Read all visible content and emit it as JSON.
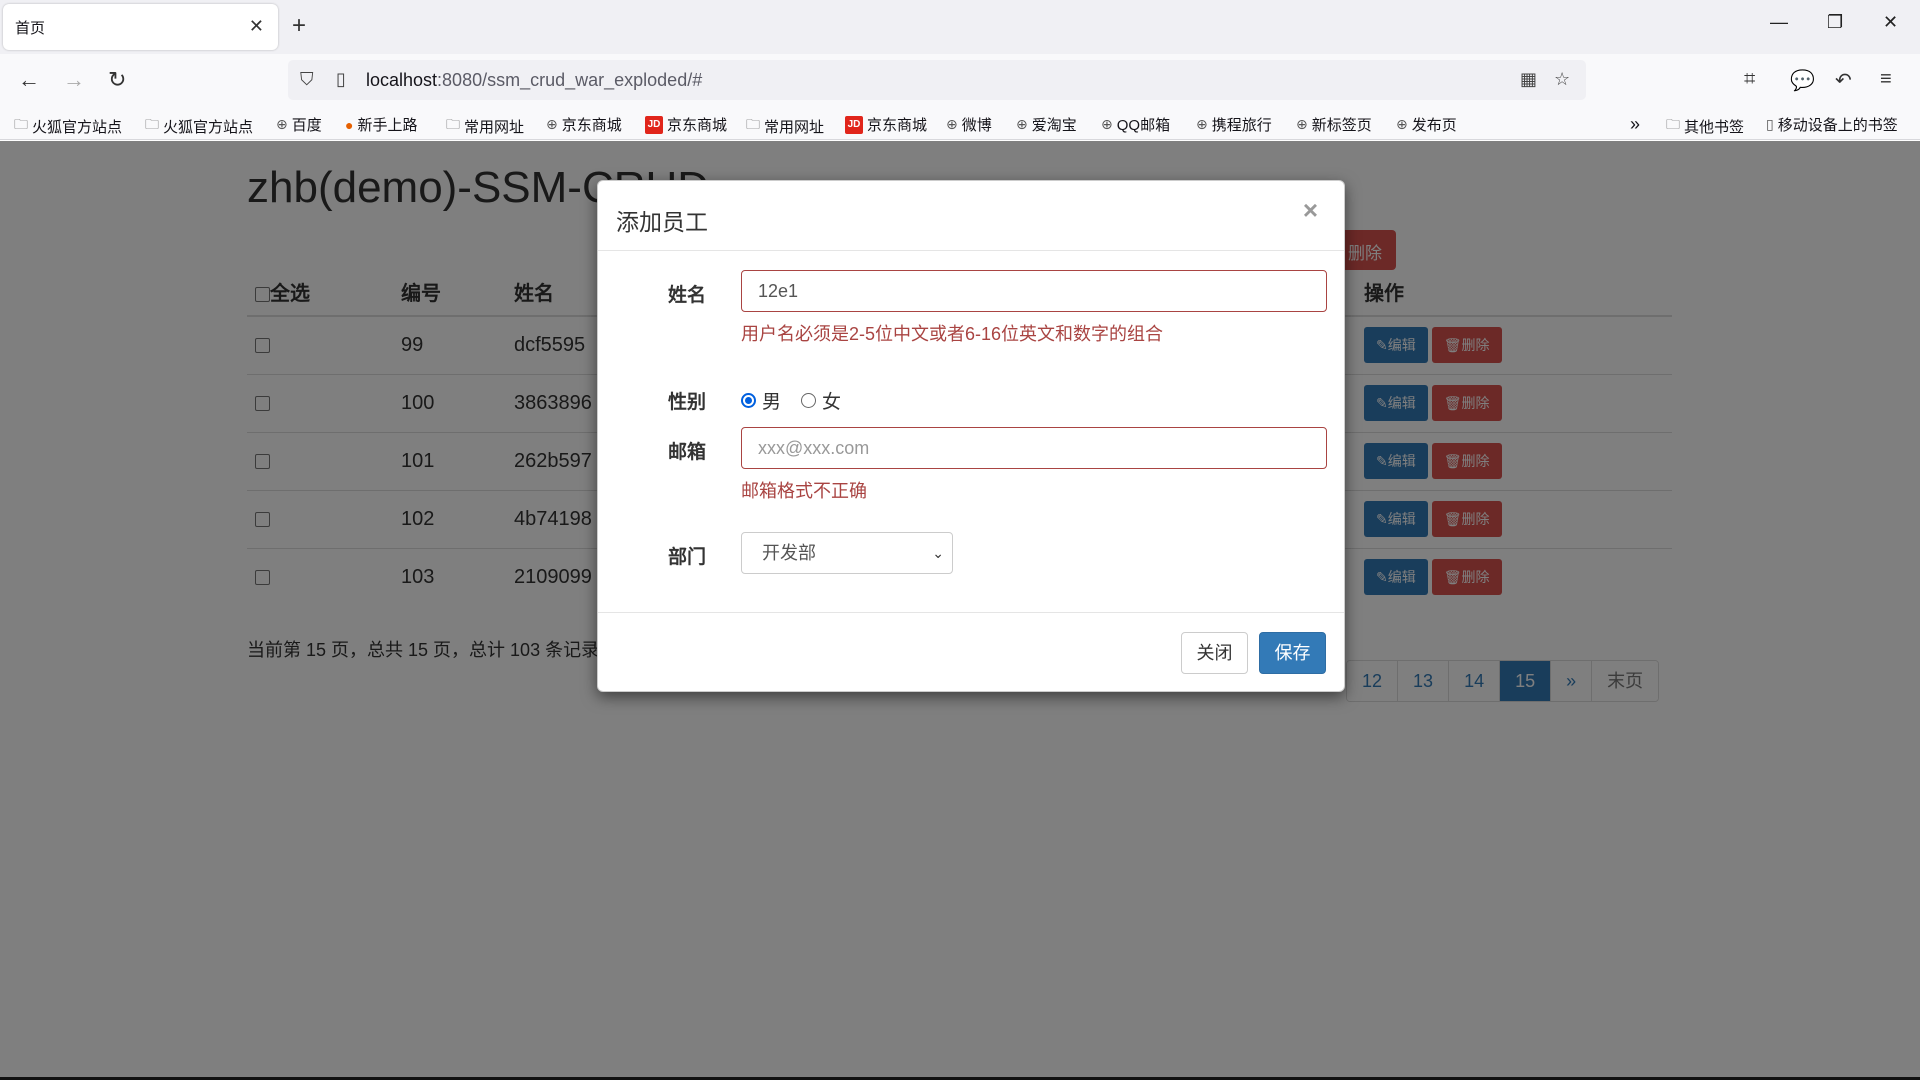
{
  "browser": {
    "tab_title": "首页",
    "tab_close": "✕",
    "new_tab": "+",
    "url_host": "localhost",
    "url_rest": ":8080/ssm_crud_war_exploded/#",
    "bookmarks": [
      "火狐官方站点",
      "火狐官方站点",
      "百度",
      "新手上路",
      "常用网址",
      "京东商城",
      "京东商城",
      "常用网址",
      "京东商城",
      "微博",
      "爱淘宝",
      "QQ邮箱",
      "携程旅行",
      "新标签页",
      "发布页"
    ],
    "other_bookmarks": "其他书签",
    "mobile_bookmarks": "移动设备上的书签"
  },
  "page": {
    "title": "zhb(demo)-SSM-CRUD",
    "top_delete": "删除",
    "columns": {
      "select_all": "全选",
      "id": "编号",
      "name": "姓名",
      "actions": "操作"
    },
    "rows": [
      {
        "id": "99",
        "name": "dcf5595"
      },
      {
        "id": "100",
        "name": "3863896"
      },
      {
        "id": "101",
        "name": "262b597"
      },
      {
        "id": "102",
        "name": "4b74198"
      },
      {
        "id": "103",
        "name": "2109099"
      }
    ],
    "edit_label": "编辑",
    "delete_label": "删除",
    "page_info": "当前第 15 页，总共 15 页，总计 103 条记录",
    "pager": [
      "12",
      "13",
      "14",
      "15",
      "»",
      "末页"
    ]
  },
  "modal": {
    "title": "添加员工",
    "close_x": "×",
    "name_label": "姓名",
    "name_value": "12e1",
    "name_error": "用户名必须是2-5位中文或者6-16位英文和数字的组合",
    "gender_label": "性别",
    "gender_male": "男",
    "gender_female": "女",
    "gender_selected": "男",
    "email_label": "邮箱",
    "email_placeholder": "xxx@xxx.com",
    "email_error": "邮箱格式不正确",
    "dept_label": "部门",
    "dept_value": "开发部",
    "close_button": "关闭",
    "save_button": "保存"
  },
  "colors": {
    "primary": "#337ab7",
    "danger": "#d9534f",
    "error_text": "#a94442"
  }
}
